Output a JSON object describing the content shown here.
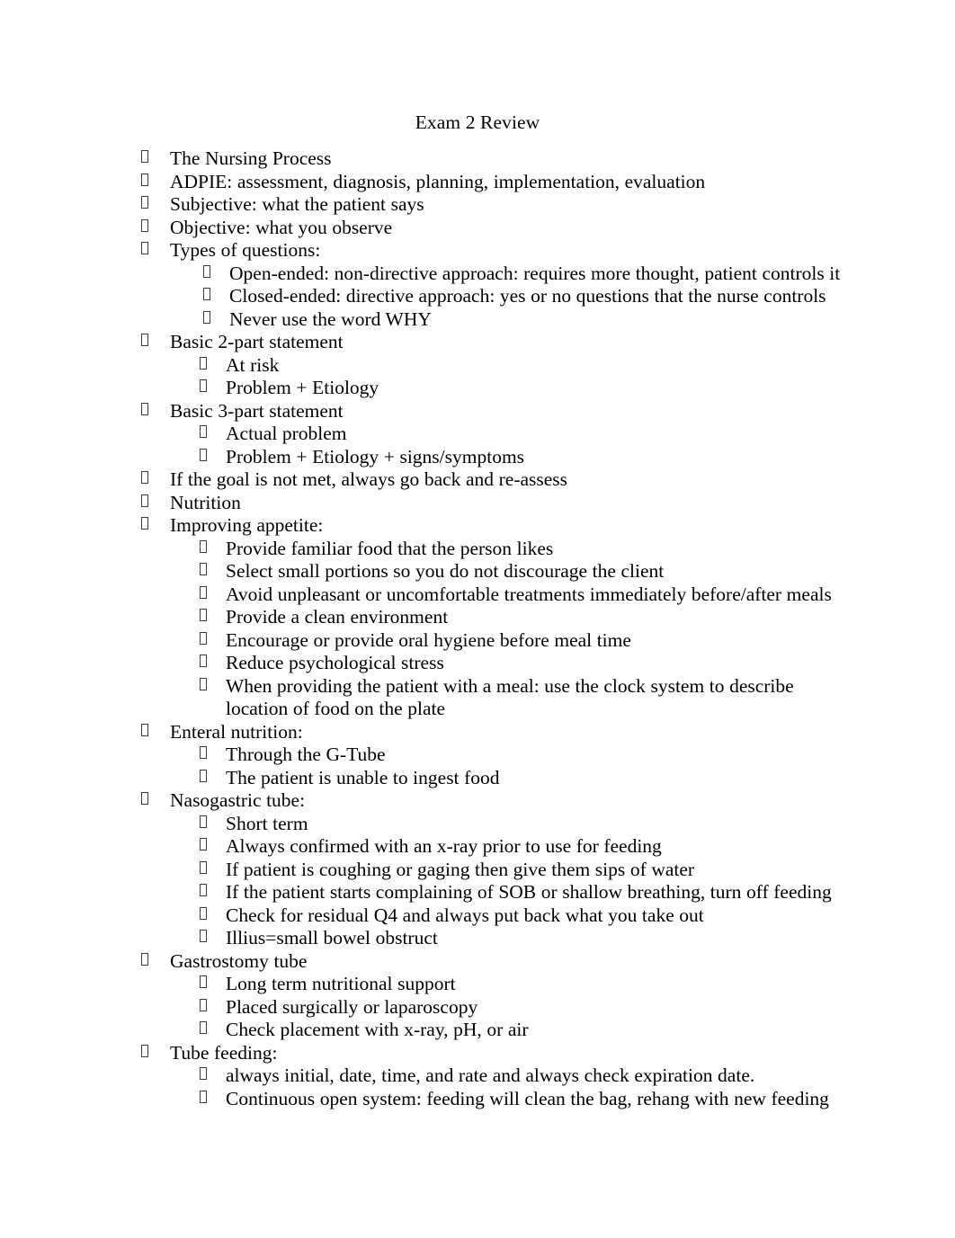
{
  "document": {
    "title": "Exam 2 Review",
    "page_background": "#ffffff",
    "text_color": "#000000",
    "bullet_glyph": "missing-glyph-box"
  },
  "outline": [
    {
      "level": 1,
      "text": "The Nursing Process"
    },
    {
      "level": 1,
      "text": "ADPIE:  assessment, diagnosis, planning, implementation, evaluation"
    },
    {
      "level": 1,
      "text": "Subjective:  what the patient says"
    },
    {
      "level": 1,
      "text": "Objective:  what you observe"
    },
    {
      "level": 1,
      "text": "Types of questions:"
    },
    {
      "level": "2b",
      "text": "Open-ended:   non-directive approach: requires more thought, patient controls it"
    },
    {
      "level": "2b",
      "text": "Closed-ended:  directive approach: yes or no questions that the nurse controls"
    },
    {
      "level": "2b",
      "text": "Never use the word WHY"
    },
    {
      "level": 1,
      "text": "Basic 2-part statement"
    },
    {
      "level": 2,
      "text": "At risk"
    },
    {
      "level": 2,
      "text": "Problem + Etiology"
    },
    {
      "level": 1,
      "text": "Basic 3-part statement"
    },
    {
      "level": 2,
      "text": "Actual problem"
    },
    {
      "level": 2,
      "text": "Problem + Etiology + signs/symptoms"
    },
    {
      "level": 1,
      "text": "If the goal is not met, always go back and re-assess"
    },
    {
      "level": 1,
      "text": "Nutrition"
    },
    {
      "level": 1,
      "text": "Improving appetite:"
    },
    {
      "level": 2,
      "text": "Provide familiar food that the person likes"
    },
    {
      "level": 2,
      "text": "Select small portions so you do not discourage the client"
    },
    {
      "level": 2,
      "text": "Avoid unpleasant or uncomfortable treatments immediately before/after meals"
    },
    {
      "level": 2,
      "text": "Provide a clean environment"
    },
    {
      "level": 2,
      "text": "Encourage or provide oral hygiene before meal time"
    },
    {
      "level": 2,
      "text": "Reduce psychological stress"
    },
    {
      "level": 2,
      "text": "When providing the patient with a meal: use the clock system to describe location of food on the plate"
    },
    {
      "level": 1,
      "text": "Enteral nutrition:"
    },
    {
      "level": 2,
      "text": "Through the G-Tube"
    },
    {
      "level": 2,
      "text": "The patient is unable to ingest food"
    },
    {
      "level": 1,
      "text": "Nasogastric tube:"
    },
    {
      "level": 2,
      "text": "Short term"
    },
    {
      "level": 2,
      "text": "Always confirmed with an x-ray prior to use for feeding"
    },
    {
      "level": 2,
      "text": "If patient is coughing or gaging then give them sips of water"
    },
    {
      "level": 2,
      "text": "If the patient starts complaining of SOB or shallow breathing, turn off feeding"
    },
    {
      "level": 2,
      "text": "Check for residual Q4 and always put back what you take out"
    },
    {
      "level": 2,
      "text": "Illius=small bowel obstruct"
    },
    {
      "level": 1,
      "text": "Gastrostomy tube"
    },
    {
      "level": 2,
      "text": "Long term nutritional support"
    },
    {
      "level": 2,
      "text": "Placed surgically or laparoscopy"
    },
    {
      "level": 2,
      "text": "Check placement with x-ray, pH, or air"
    },
    {
      "level": 1,
      "text": "Tube feeding:"
    },
    {
      "level": 2,
      "text": "always initial, date, time, and rate and always check expiration date."
    },
    {
      "level": 2,
      "text": "Continuous open system: feeding will clean the bag, rehang with new feeding"
    }
  ]
}
